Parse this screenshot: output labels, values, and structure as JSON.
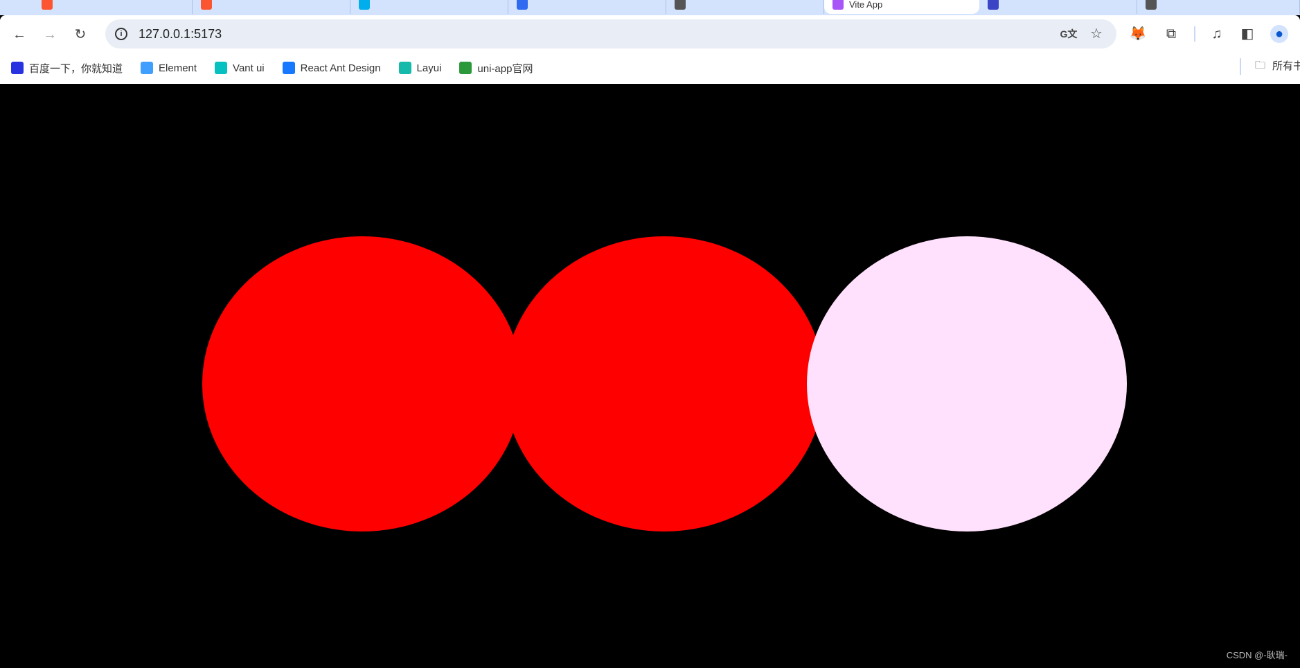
{
  "tabs": [
    {
      "icon": "csdn-icon",
      "color": "#fc5531"
    },
    {
      "icon": "csdn-icon",
      "color": "#fc5531"
    },
    {
      "icon": "bilibili-icon",
      "color": "#00aeec"
    },
    {
      "icon": "baidu-translate-icon",
      "color": "#2e6bf0"
    },
    {
      "icon": "raycaster-icon",
      "color": "#555555"
    },
    {
      "icon": "vite-icon",
      "color": "#a855f7",
      "label": "Vite App",
      "active": true
    },
    {
      "icon": "mongoose-icon",
      "color": "#3b44c4"
    },
    {
      "icon": "tab-icon",
      "color": "#555555"
    }
  ],
  "address": {
    "url": "127.0.0.1:5173"
  },
  "bookmarks": [
    {
      "label": "百度一下，你就知道",
      "icon": "baidu-icon",
      "color": "#2932e1"
    },
    {
      "label": "Element",
      "icon": "element-icon",
      "color": "#409eff"
    },
    {
      "label": "Vant ui",
      "icon": "vant-icon",
      "color": "#07c1c1"
    },
    {
      "label": "React Ant Design",
      "icon": "antd-icon",
      "color": "#1677ff"
    },
    {
      "label": "Layui",
      "icon": "layui-icon",
      "color": "#16baaa"
    },
    {
      "label": "uni-app官网",
      "icon": "uniapp-icon",
      "color": "#2b9939"
    }
  ],
  "all_bookmarks_label": "所有书签",
  "circles": [
    {
      "color": "#ff0000"
    },
    {
      "color": "#ff0000"
    },
    {
      "color": "#ffe1fd"
    }
  ],
  "watermark": "CSDN @-耿瑞-"
}
